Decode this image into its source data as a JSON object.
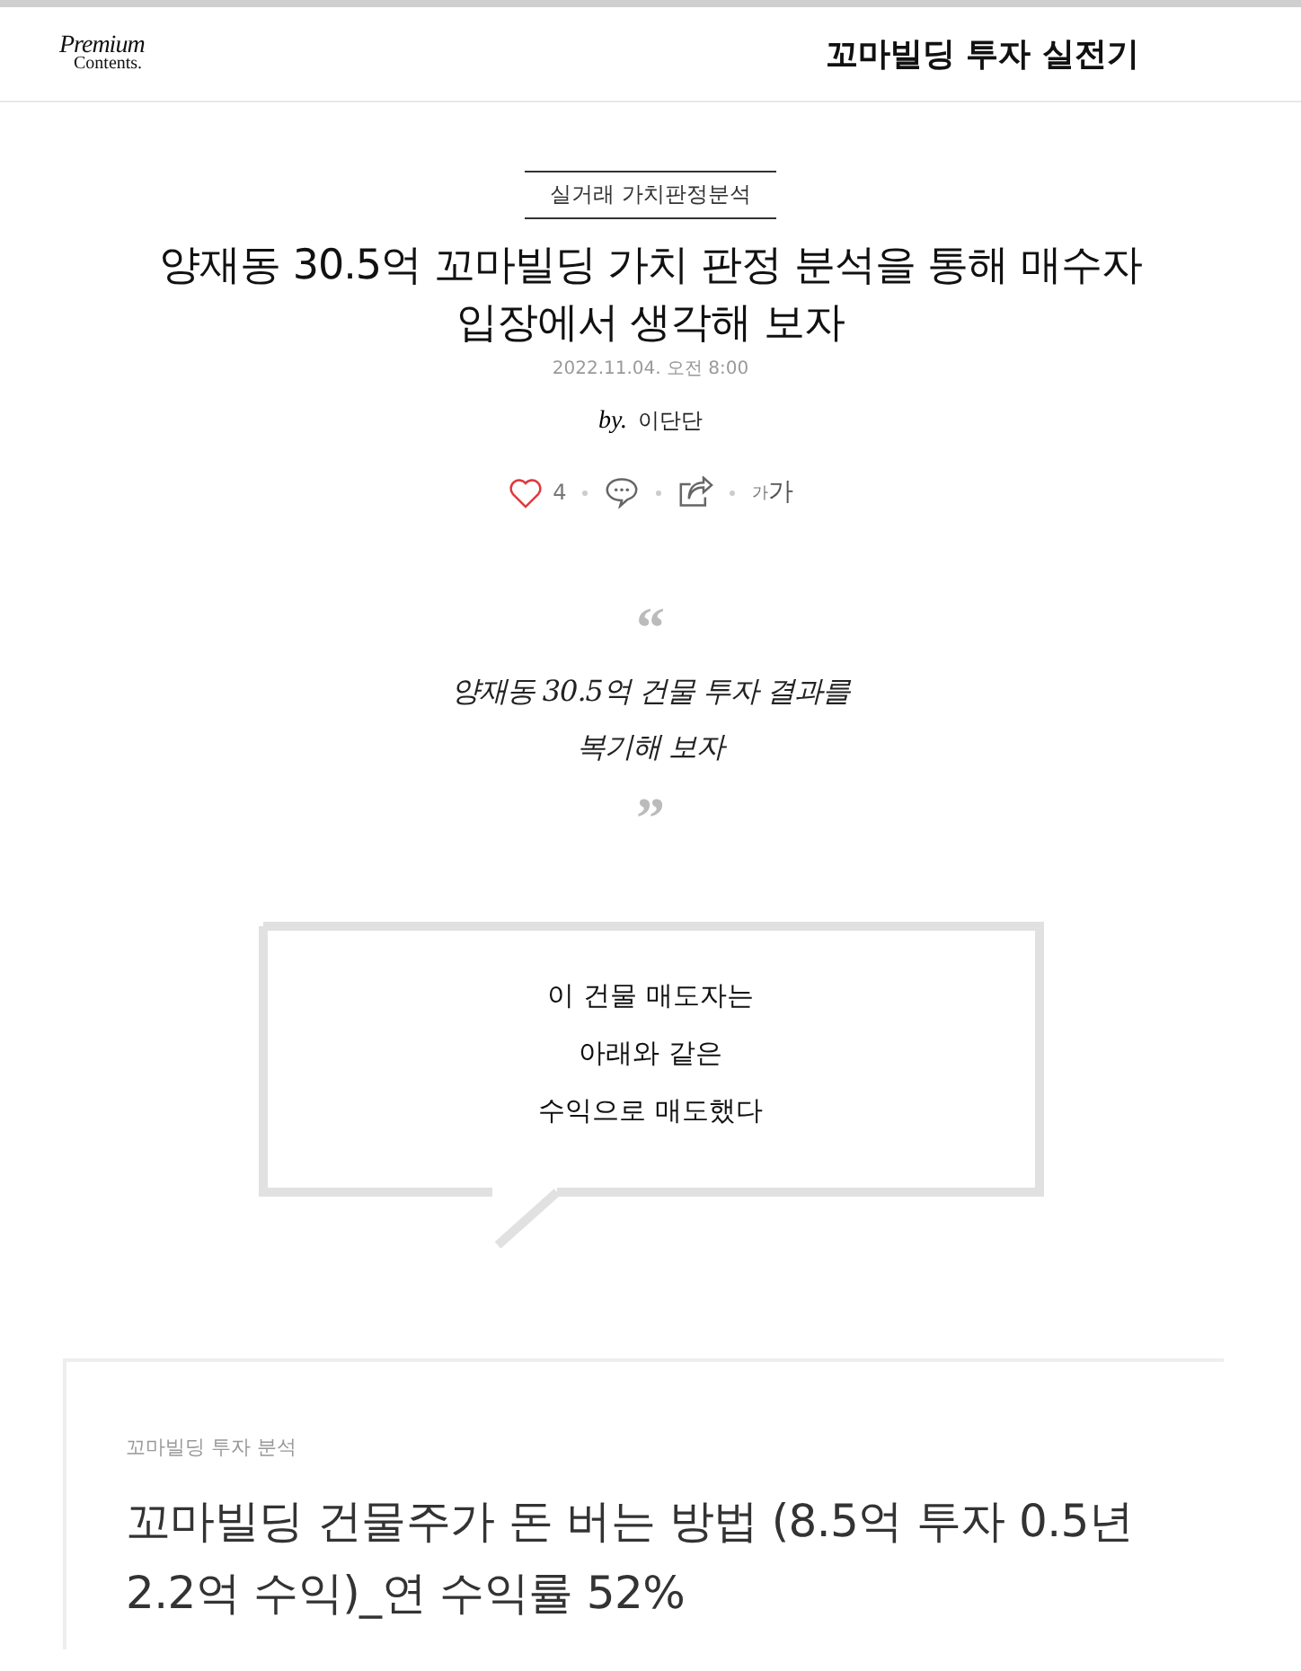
{
  "header": {
    "logo_top": "Premium",
    "logo_bottom": "Contents.",
    "title": "꼬마빌딩 투자 실전기"
  },
  "article": {
    "category": "실거래 가치판정분석",
    "headline": "양재동 30.5억 꼬마빌딩 가치 판정 분석을 통해 매수자 입장에서 생각해 보자",
    "date": "2022.11.04. 오전 8:00",
    "by": "by.",
    "author": "이단단",
    "actions": {
      "like_count": "4",
      "font_small": "가",
      "font_large": "가"
    }
  },
  "quote": {
    "open_mark": "“",
    "lines": [
      "양재동 30.5억 건물 투자 결과를",
      "복기해 보자"
    ],
    "close_mark": "”"
  },
  "callout": {
    "lines": [
      "이 건물 매도자는",
      "아래와 같은",
      "수익으로 매도했다"
    ]
  },
  "related": {
    "category": "꼬마빌딩 투자 분석",
    "title": "꼬마빌딩 건물주가 돈 버는 방법 (8.5억 투자 0.5년 2.2억 수익)_연 수익률 52%"
  }
}
